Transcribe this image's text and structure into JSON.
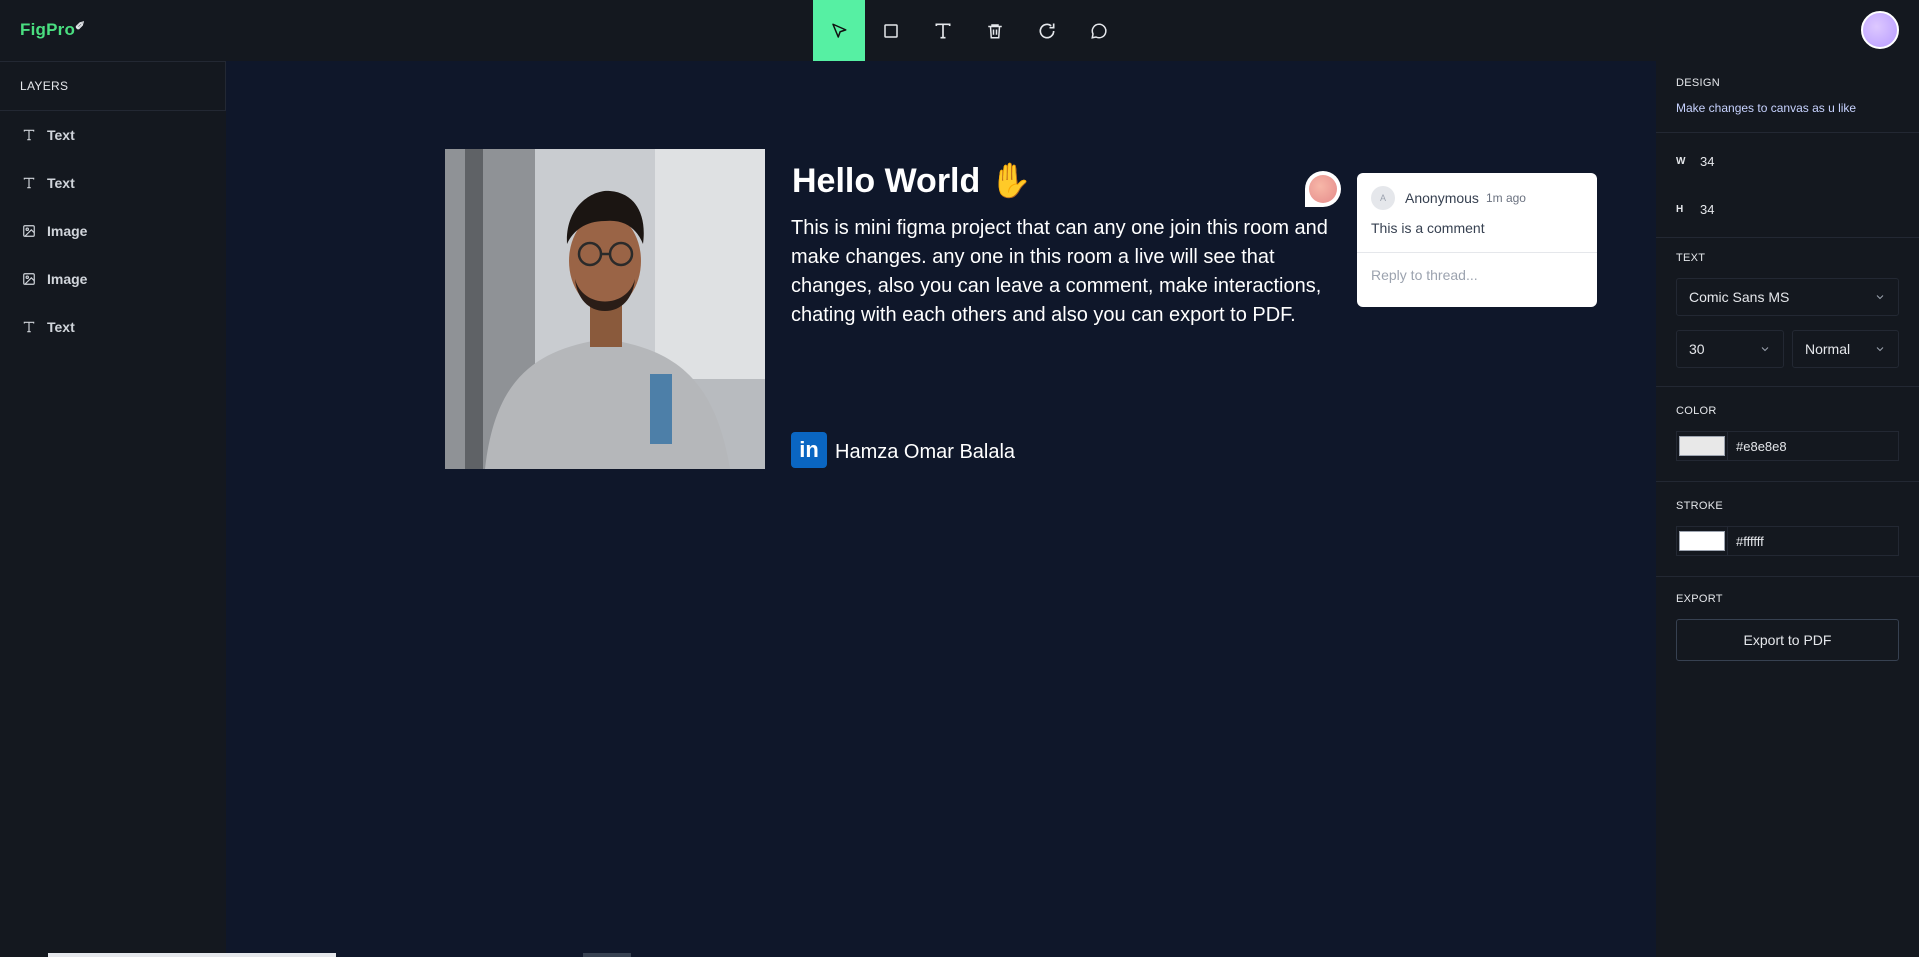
{
  "app": {
    "logo": "FigPro"
  },
  "toolbar": {
    "tools": [
      {
        "name": "select",
        "active": true
      },
      {
        "name": "rectangle"
      },
      {
        "name": "text"
      },
      {
        "name": "delete"
      },
      {
        "name": "reset"
      },
      {
        "name": "comments"
      }
    ]
  },
  "layers": {
    "title": "LAYERS",
    "items": [
      {
        "label": "Text",
        "icon": "text-icon"
      },
      {
        "label": "Text",
        "icon": "text-icon"
      },
      {
        "label": "Image",
        "icon": "image-icon"
      },
      {
        "label": "Image",
        "icon": "image-icon"
      },
      {
        "label": "Text",
        "icon": "text-icon"
      }
    ]
  },
  "canvas": {
    "heading": "Hello World ✋",
    "description": "This is mini figma project that can any one join this room and make changes. any one in this room a live will see that changes, also you can leave a comment, make interactions, chating with each others and also you can export to PDF.",
    "linkedin_badge": "in",
    "author": "Hamza Omar Balala"
  },
  "comment": {
    "avatar_initial": "A",
    "author": "Anonymous",
    "time": "1m ago",
    "body": "This is a comment",
    "reply_placeholder": "Reply to thread..."
  },
  "design": {
    "title": "DESIGN",
    "subtitle": "Make changes to canvas as u like",
    "w_label": "W",
    "w_value": "34",
    "h_label": "H",
    "h_value": "34",
    "text_title": "TEXT",
    "font_family": "Comic Sans MS",
    "font_size": "30",
    "font_weight": "Normal",
    "color_title": "COLOR",
    "color_value": "#e8e8e8",
    "stroke_title": "STROKE",
    "stroke_value": "#ffffff",
    "export_title": "EXPORT",
    "export_button": "Export to PDF"
  },
  "colors": {
    "accent": "#56f0a3",
    "background": "#0f172a",
    "panel": "#14181f",
    "linkedin": "#0a66c2"
  }
}
